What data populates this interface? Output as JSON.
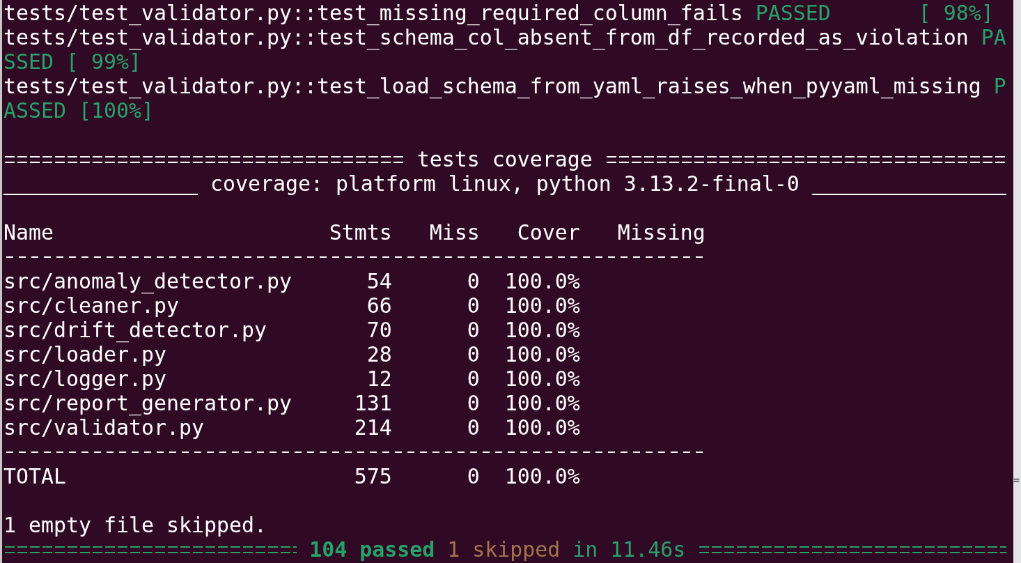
{
  "test_results": [
    {
      "test": "tests/test_validator.py::test_missing_required_column_fails",
      "passed": true,
      "status": "PASSED",
      "progress": "[ 98%]"
    },
    {
      "test": "tests/test_validator.py::test_schema_col_absent_from_df_recorded_as_violation",
      "passed": true,
      "status": "PA",
      "status_rest": "SSED",
      "progress": "[ 99%]"
    },
    {
      "test": "tests/test_validator.py::test_load_schema_from_yaml_raises_when_pyyaml_missing",
      "passed": true,
      "status": "P",
      "status_rest": "ASSED",
      "progress": "[100%]"
    }
  ],
  "coverage": {
    "title": "tests coverage",
    "subtitle": "coverage: platform linux, python 3.13.2-final-0",
    "table": {
      "columns": [
        "Name",
        "Stmts",
        "Miss",
        "Cover",
        "Missing"
      ],
      "rows": [
        [
          "src/anomaly_detector.py",
          "54",
          "0",
          "100.0%"
        ],
        [
          "src/cleaner.py",
          "66",
          "0",
          "100.0%"
        ],
        [
          "src/drift_detector.py",
          "70",
          "0",
          "100.0%"
        ],
        [
          "src/loader.py",
          "28",
          "0",
          "100.0%"
        ],
        [
          "src/logger.py",
          "12",
          "0",
          "100.0%"
        ],
        [
          "src/report_generator.py",
          "131",
          "0",
          "100.0%"
        ],
        [
          "src/validator.py",
          "214",
          "0",
          "100.0%"
        ]
      ],
      "total": [
        "TOTAL",
        "575",
        "0",
        "100.0%"
      ]
    },
    "note": "1 empty file skipped."
  },
  "summary": {
    "passed": true,
    "parts": [
      {
        "text": "104 passed",
        "kind": "passed"
      },
      {
        "text": "1 skipped",
        "kind": "skipped"
      },
      {
        "text": "in 11.46s",
        "kind": "duration"
      }
    ]
  },
  "background_window": {
    "text": "="
  }
}
